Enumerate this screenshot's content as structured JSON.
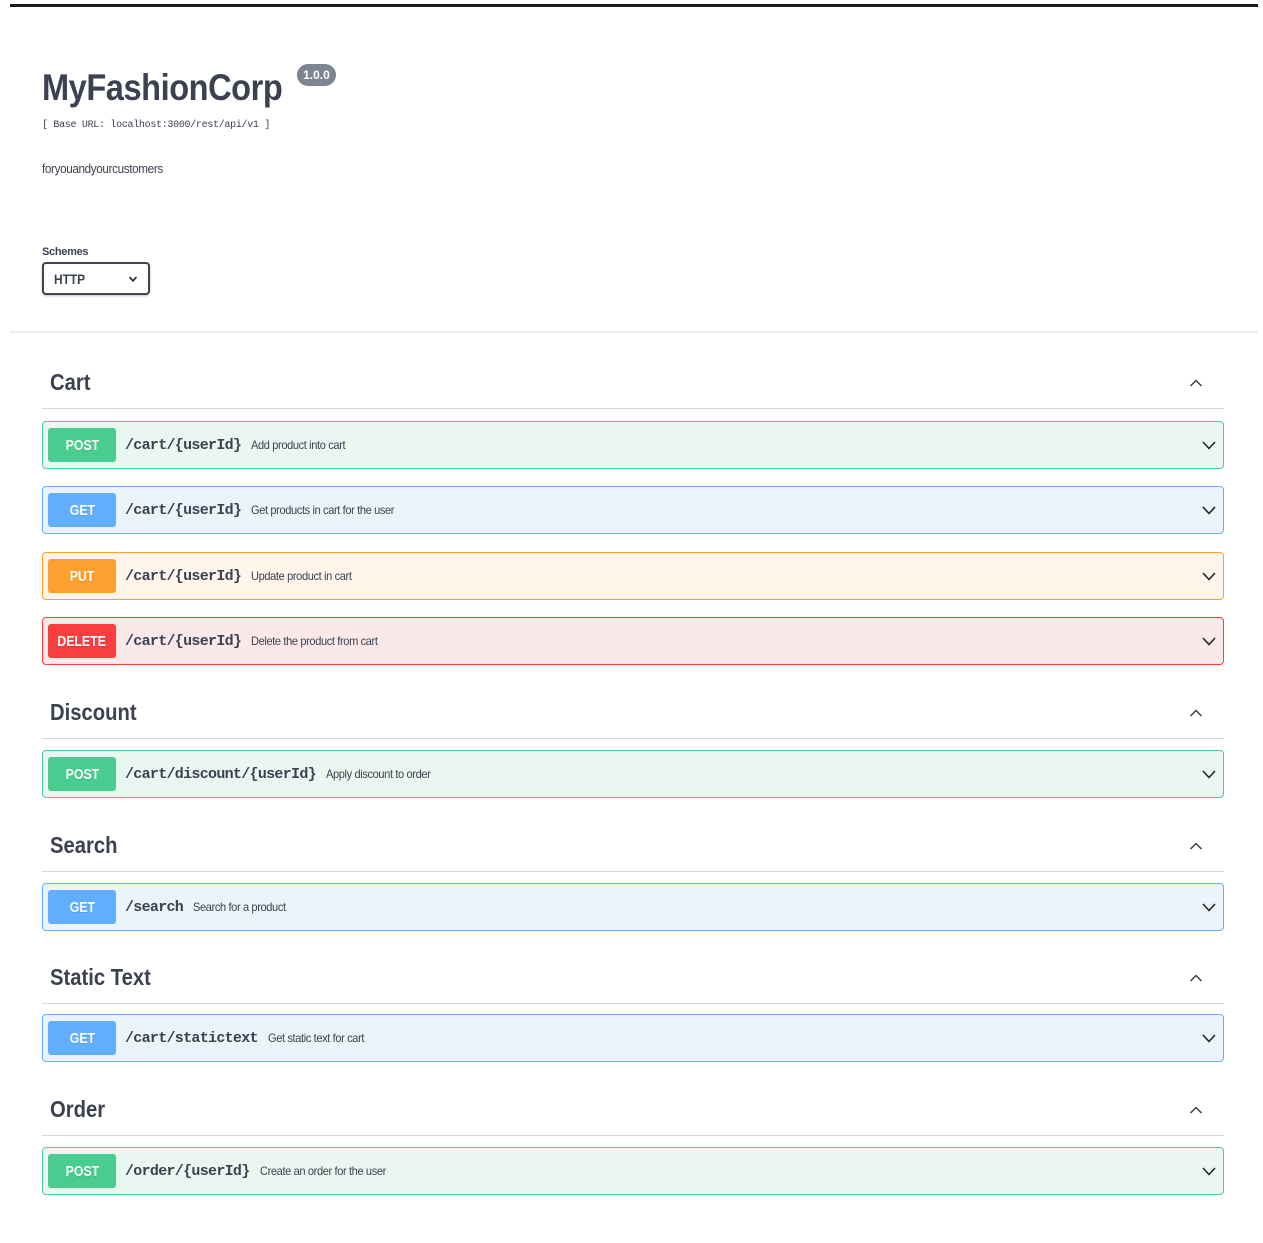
{
  "info": {
    "title": "MyFashionCorp",
    "version": "1.0.0",
    "base_url": "[ Base URL: localhost:3000/rest/api/v1 ]",
    "description": "foryouandyourcustomers"
  },
  "schemes": {
    "label": "Schemes",
    "selected": "HTTP"
  },
  "colors": {
    "post": "#49cc90",
    "get": "#61affe",
    "put": "#fca130",
    "delete": "#f93e3e"
  },
  "tags": [
    {
      "name": "Cart",
      "operations": [
        {
          "method": "POST",
          "path": "/cart/{userId}",
          "summary": "Add product into cart"
        },
        {
          "method": "GET",
          "path": "/cart/{userId}",
          "summary": "Get products in cart for the user"
        },
        {
          "method": "PUT",
          "path": "/cart/{userId}",
          "summary": "Update product in cart"
        },
        {
          "method": "DELETE",
          "path": "/cart/{userId}",
          "summary": "Delete the product from cart"
        }
      ]
    },
    {
      "name": "Discount",
      "operations": [
        {
          "method": "POST",
          "path": "/cart/discount/{userId}",
          "summary": "Apply discount to order"
        }
      ]
    },
    {
      "name": "Search",
      "operations": [
        {
          "method": "GET",
          "path": "/search",
          "summary": "Search for a product"
        }
      ]
    },
    {
      "name": "Static Text",
      "operations": [
        {
          "method": "GET",
          "path": "/cart/statictext",
          "summary": "Get static text for cart"
        }
      ]
    },
    {
      "name": "Order",
      "operations": [
        {
          "method": "POST",
          "path": "/order/{userId}",
          "summary": "Create an order for the user"
        }
      ]
    }
  ]
}
